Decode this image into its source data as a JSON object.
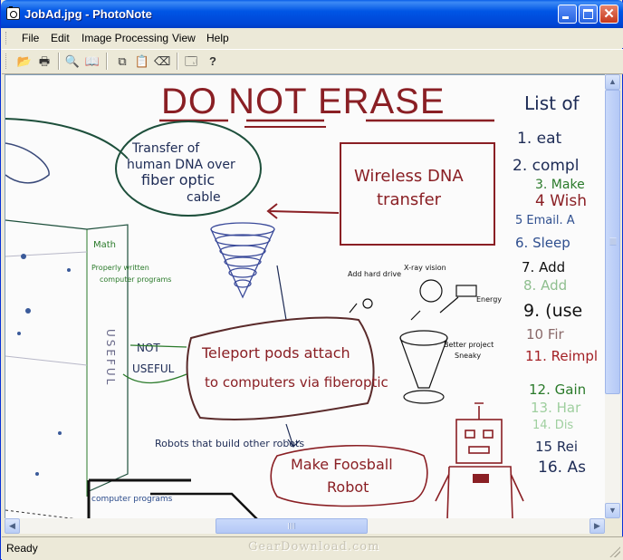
{
  "window": {
    "title": "JobAd.jpg - PhotoNote",
    "minimize_icon": "minimize-icon",
    "maximize_icon": "maximize-icon",
    "close_icon": "close-icon",
    "close_glyph": "✕"
  },
  "menu": {
    "file": "File",
    "edit": "Edit",
    "image_processing": "Image Processing",
    "view": "View",
    "help": "Help"
  },
  "toolbar": {
    "open": "📂",
    "print": "🖶",
    "print_preview": "🔍",
    "book": "📖",
    "copy": "⧉",
    "paste": "📋",
    "erase": "⌫",
    "properties": "🗔",
    "help": "?"
  },
  "whiteboard": {
    "header": "DO NOT ERASE",
    "list_title": "List of",
    "list_items": [
      "1. eat",
      "2. compl",
      "3. Make",
      "4 Wish",
      "5 Email. A",
      "6. Sleep",
      "7. Add",
      "8. Add",
      "9. (use",
      "10 Fir",
      "11. Reimpl",
      "12. Gain",
      "13. Har",
      "14. Dis",
      "15 Rei",
      "16. As"
    ],
    "bubble_dna": [
      "Transfer of",
      "human DNA over",
      "fiber optic",
      "cable"
    ],
    "box_wireless": [
      "Wireless DNA",
      "transfer"
    ],
    "bubble_teleport": [
      "Teleport pods attach",
      "to computers via fiberoptic"
    ],
    "robots_label": "Robots that build other robots",
    "bubble_foosball": [
      "Make Foosball",
      "Robot"
    ],
    "math_note": "Math",
    "programs_note": [
      "Properly written",
      "computer programs"
    ],
    "useful_vertical": "USEFUL",
    "not_useful": [
      "NOT",
      "USEFUL"
    ],
    "computer_programs": "computer programs",
    "sketch_notes": [
      "Add hard drive",
      "X-ray vision",
      "Energy",
      "Better project",
      "Sneaky"
    ]
  },
  "statusbar": {
    "status": "Ready",
    "watermark": "GearDownload.com"
  }
}
